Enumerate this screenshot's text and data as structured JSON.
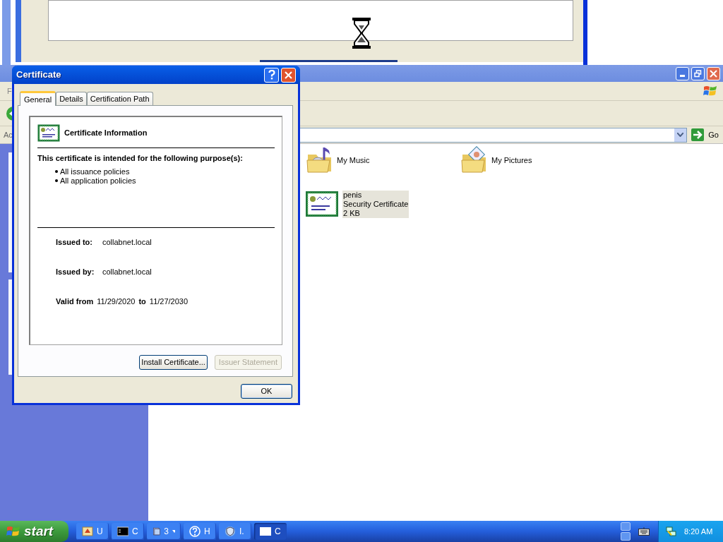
{
  "explorer": {
    "menu_bar": {
      "visible_text": "F"
    },
    "address_bar": {
      "label": "Ac",
      "go": "Go"
    },
    "items": [
      {
        "kind": "music-folder",
        "name": "My Music",
        "selected": false
      },
      {
        "kind": "pictures-folder",
        "name": "My Pictures",
        "selected": false
      },
      {
        "kind": "certificate",
        "name": "penis",
        "type": "Security Certificate",
        "size": "2 KB",
        "selected": true
      }
    ]
  },
  "dialog": {
    "title": "Certificate",
    "tabs": [
      {
        "label": "General",
        "selected": true
      },
      {
        "label": "Details",
        "selected": false
      },
      {
        "label": "Certification Path",
        "selected": false
      }
    ],
    "heading": "Certificate Information",
    "purpose_heading": "This certificate is intended for the following purpose(s):",
    "purposes": [
      "All issuance policies",
      "All application policies"
    ],
    "fields": [
      {
        "label": "Issued to:",
        "value": "collabnet.local"
      },
      {
        "label": "Issued by:",
        "value": "collabnet.local"
      }
    ],
    "validity": {
      "label": "Valid from",
      "from": "11/29/2020",
      "to_label": "to",
      "to": "11/27/2030"
    },
    "buttons": [
      {
        "label": "Install Certificate...",
        "disabled": false
      },
      {
        "label": "Issuer Statement",
        "disabled": true
      }
    ],
    "ok": "OK"
  },
  "taskbar": {
    "start": "start",
    "tasks": [
      {
        "kind": "setup",
        "label": "U",
        "selected": false
      },
      {
        "kind": "console",
        "label": "C",
        "selected": false
      },
      {
        "kind": "group",
        "label": "3",
        "selected": false
      },
      {
        "kind": "help",
        "label": "H",
        "selected": false
      },
      {
        "kind": "shield",
        "label": "I.",
        "selected": false
      },
      {
        "kind": "window",
        "label": "C",
        "selected": true
      }
    ],
    "clock": "8:20 AM"
  }
}
